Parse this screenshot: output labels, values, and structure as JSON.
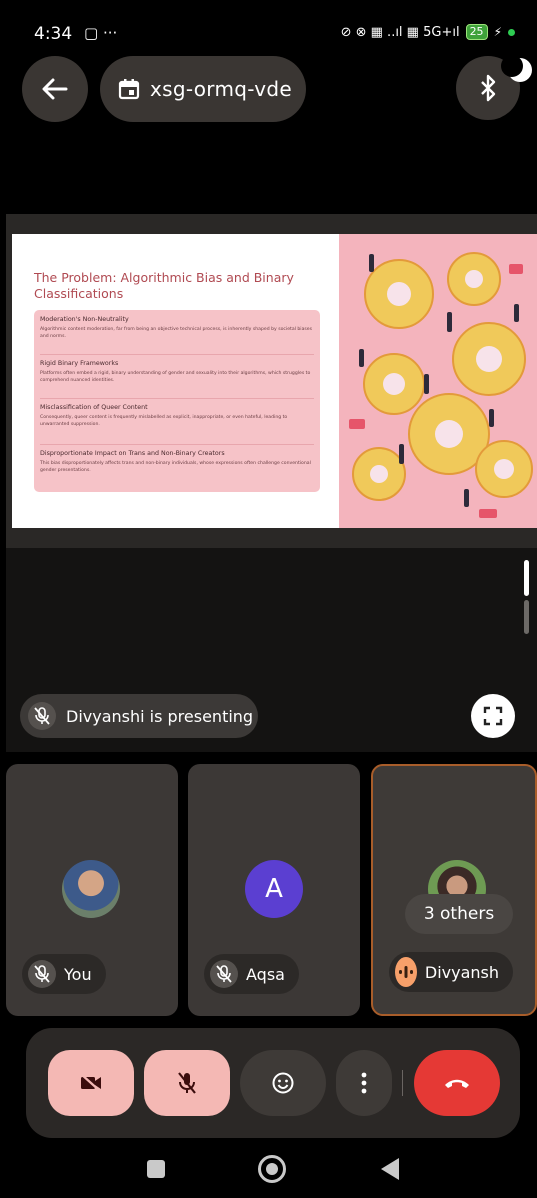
{
  "status_bar": {
    "time": "4:34",
    "left_icons": "▢ ···",
    "right_icons": "⊘ ⊗ ▦ ..ıl ▦ 5G+ıl",
    "battery": "25"
  },
  "header": {
    "meeting_code": "xsg-ormq-vde",
    "back_icon": "arrow-left-icon",
    "calendar_icon": "calendar-icon",
    "bluetooth_icon": "bluetooth-icon"
  },
  "slide": {
    "title": "The Problem: Algorithmic Bias and Binary Classifications",
    "items": [
      {
        "heading": "Moderation's Non-Neutrality",
        "body": "Algorithmic content moderation, far from being an objective technical process, is inherently shaped by societal biases and norms."
      },
      {
        "heading": "Rigid Binary Frameworks",
        "body": "Platforms often embed a rigid, binary understanding of gender and sexuality into their algorithms, which struggles to comprehend nuanced identities."
      },
      {
        "heading": "Misclassification of Queer Content",
        "body": "Consequently, queer content is frequently mislabelled as explicit, inappropriate, or even hateful, leading to unwarranted suppression."
      },
      {
        "heading": "Disproportionate Impact on Trans and Non-Binary Creators",
        "body": "This bias disproportionately affects trans and non-binary individuals, whose expressions often challenge conventional gender presentations."
      }
    ]
  },
  "presenting": {
    "label": "Divyanshi is presenting"
  },
  "tiles": [
    {
      "name": "You",
      "muted": true
    },
    {
      "name": "Aqsa",
      "avatar_letter": "A",
      "muted": true
    },
    {
      "name": "Divyansh",
      "overlay": "3 others",
      "speaking": true
    }
  ],
  "colors": {
    "end_call": "#e53935",
    "muted_control": "#f4b8b4",
    "active_tile_border": "#a85d2a",
    "avatar_letter_bg": "#5b3fd1"
  }
}
